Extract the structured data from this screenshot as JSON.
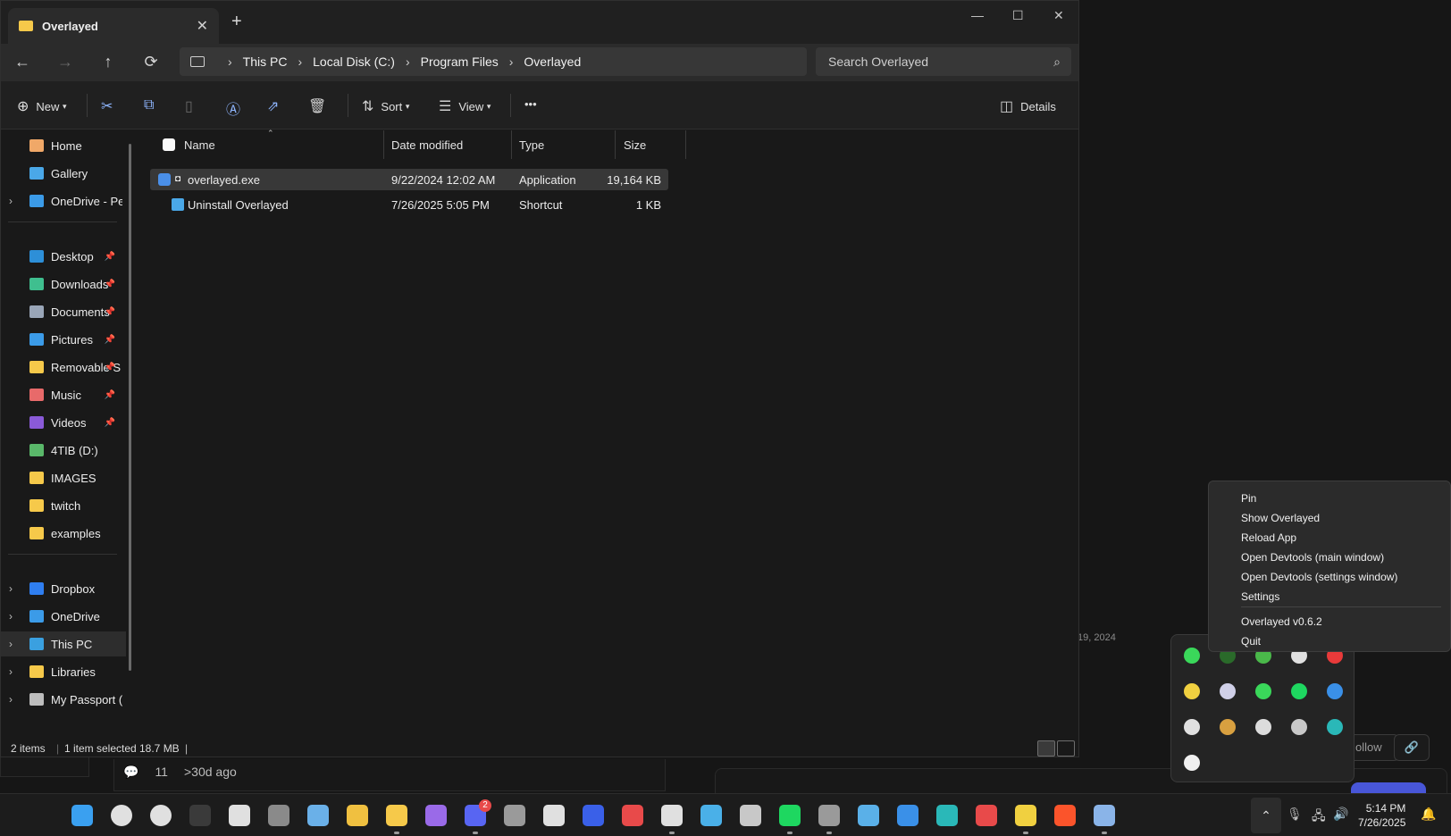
{
  "explorer": {
    "tab_title": "Overlayed",
    "tab_close": "✕",
    "new_tab": "+",
    "win_min": "—",
    "win_max": "☐",
    "win_close": "✕",
    "nav": {
      "back": "←",
      "forward": "→",
      "up": "↑",
      "refresh": "⟳"
    },
    "breadcrumb": [
      "This PC",
      "Local Disk (C:)",
      "Program Files",
      "Overlayed"
    ],
    "breadcrumb_sep": "›",
    "search_placeholder": "Search Overlayed",
    "commands": {
      "new": "New",
      "sort": "Sort",
      "view": "View",
      "more": "•••",
      "details": "Details"
    },
    "nav_pane": [
      {
        "label": "Home",
        "icon": "home-icon",
        "color": "#f0a868"
      },
      {
        "label": "Gallery",
        "icon": "gallery-icon",
        "color": "#4aa8e8"
      },
      {
        "label": "OneDrive - Pers",
        "icon": "cloud-icon",
        "color": "#3b9be8",
        "chevron": true
      },
      {
        "label": "Desktop",
        "icon": "desktop-icon",
        "color": "#2d8fd8",
        "pinned": true
      },
      {
        "label": "Downloads",
        "icon": "download-icon",
        "color": "#3fbf8f",
        "pinned": true
      },
      {
        "label": "Documents",
        "icon": "document-icon",
        "color": "#9aa6b8",
        "pinned": true
      },
      {
        "label": "Pictures",
        "icon": "pictures-icon",
        "color": "#3b9be8",
        "pinned": true
      },
      {
        "label": "Removable S",
        "icon": "folder-icon",
        "color": "#f6c94a",
        "pinned": true
      },
      {
        "label": "Music",
        "icon": "music-icon",
        "color": "#e86a6a",
        "pinned": true
      },
      {
        "label": "Videos",
        "icon": "video-icon",
        "color": "#8a5ad8",
        "pinned": true
      },
      {
        "label": "4TIB (D:)",
        "icon": "drive-icon",
        "color": "#5ab86a"
      },
      {
        "label": "IMAGES",
        "icon": "folder-icon",
        "color": "#f6c94a"
      },
      {
        "label": "twitch",
        "icon": "folder-icon",
        "color": "#f6c94a"
      },
      {
        "label": "examples",
        "icon": "folder-icon",
        "color": "#f6c94a"
      },
      {
        "label": "Dropbox",
        "icon": "dropbox-icon",
        "color": "#2f7ef0",
        "chevron": true
      },
      {
        "label": "OneDrive",
        "icon": "cloud-icon",
        "color": "#3b9be8",
        "chevron": true
      },
      {
        "label": "This PC",
        "icon": "computer-icon",
        "color": "#3aa0e0",
        "chevron": true,
        "selected": true
      },
      {
        "label": "Libraries",
        "icon": "folder-icon",
        "color": "#f6c94a",
        "chevron": true
      },
      {
        "label": "My Passport (E:)",
        "icon": "usb-drive-icon",
        "color": "#bdbdbd",
        "chevron": true
      }
    ],
    "columns": [
      "Name",
      "Date modified",
      "Type",
      "Size"
    ],
    "files": [
      {
        "name": "overlayed.exe",
        "date": "9/22/2024 12:02 AM",
        "type": "Application",
        "size": "19,164 KB",
        "selected": true
      },
      {
        "name": "Uninstall Overlayed",
        "date": "7/26/2025 5:05 PM",
        "type": "Shortcut",
        "size": "1 KB",
        "selected": false
      }
    ],
    "status": {
      "count": "2 items",
      "selection": "1 item selected",
      "size": "18.7 MB"
    }
  },
  "background_page": {
    "date": "19, 2024",
    "follow": "ollow",
    "link": "🔗",
    "comments": "11",
    "age": ">30d ago"
  },
  "context_menu": {
    "items": [
      "Pin",
      "Show Overlayed",
      "Reload App",
      "Open Devtools (main window)",
      "Open Devtools (settings window)",
      "Settings"
    ],
    "version": "Overlayed v0.6.2",
    "quit": "Quit"
  },
  "tray_icons": [
    {
      "name": "razer-icon",
      "color": "#3ad85a"
    },
    {
      "name": "nvidia-icon",
      "color": "#2a6a2a"
    },
    {
      "name": "network-share-icon",
      "color": "#4ab84a"
    },
    {
      "name": "usb-icon",
      "color": "#e0e0e0"
    },
    {
      "name": "antivirus-icon",
      "color": "#e83a3a"
    },
    {
      "name": "norton-icon",
      "color": "#f0d040"
    },
    {
      "name": "printer-icon",
      "color": "#d0d0e8"
    },
    {
      "name": "xbox-icon",
      "color": "#3ad85a"
    },
    {
      "name": "spotify-icon",
      "color": "#1ed760"
    },
    {
      "name": "defender-warning-icon",
      "color": "#3a90e8"
    },
    {
      "name": "usb-stick-icon",
      "color": "#e0e0e0"
    },
    {
      "name": "app-grid-icon",
      "color": "#d8a040"
    },
    {
      "name": "cup-icon",
      "color": "#dcdcdc"
    },
    {
      "name": "globe-icon",
      "color": "#c8c8c8"
    },
    {
      "name": "tool-icon",
      "color": "#2ab8b8"
    },
    {
      "name": "recorder-icon",
      "color": "#f0f0f0"
    }
  ],
  "taskbar": {
    "icons": [
      {
        "name": "start-icon",
        "color": "#3aa0f0"
      },
      {
        "name": "search-icon",
        "color": "#e0e0e0"
      },
      {
        "name": "task-view-icon",
        "color": "#e0e0e0"
      },
      {
        "name": "mouse-icon",
        "color": "#3a3a3a"
      },
      {
        "name": "settings-gear-icon",
        "color": "#e0e0e0"
      },
      {
        "name": "game-icon",
        "color": "#8a8a8a"
      },
      {
        "name": "steam-icon",
        "color": "#6ab0e8"
      },
      {
        "name": "chrome-app-icon",
        "color": "#f0c040"
      },
      {
        "name": "file-explorer-icon",
        "color": "#f6c94a"
      },
      {
        "name": "twitch-icon",
        "color": "#9a6ae8"
      },
      {
        "name": "discord-icon",
        "color": "#5865f2"
      },
      {
        "name": "audio-app-icon",
        "color": "#9a9a9a"
      },
      {
        "name": "pen-icon",
        "color": "#e0e0e0"
      },
      {
        "name": "keyboard-icon",
        "color": "#3a60e8"
      },
      {
        "name": "calendar-icon",
        "color": "#e84a4a"
      },
      {
        "name": "printer-app-icon",
        "color": "#e0e0e0"
      },
      {
        "name": "video-editor-icon",
        "color": "#4ab0e8"
      },
      {
        "name": "chat-app-icon",
        "color": "#c8c8c8"
      },
      {
        "name": "spotify-icon",
        "color": "#1ed760"
      },
      {
        "name": "obs-icon",
        "color": "#9a9a9a"
      },
      {
        "name": "network-app-icon",
        "color": "#5ab0e8"
      },
      {
        "name": "waveform-icon",
        "color": "#3a90e8"
      },
      {
        "name": "circle-app-icon",
        "color": "#2ab8b8"
      },
      {
        "name": "voicemeeter-icon",
        "color": "#e84a4a"
      },
      {
        "name": "globe-app-icon",
        "color": "#f0d040"
      },
      {
        "name": "brave-icon",
        "color": "#fb542b"
      },
      {
        "name": "settings-icon",
        "color": "#8ab4e8"
      }
    ],
    "discord_badge": "2",
    "tray_up": "⌃",
    "clock_time": "5:14 PM",
    "clock_date": "7/26/2025"
  }
}
